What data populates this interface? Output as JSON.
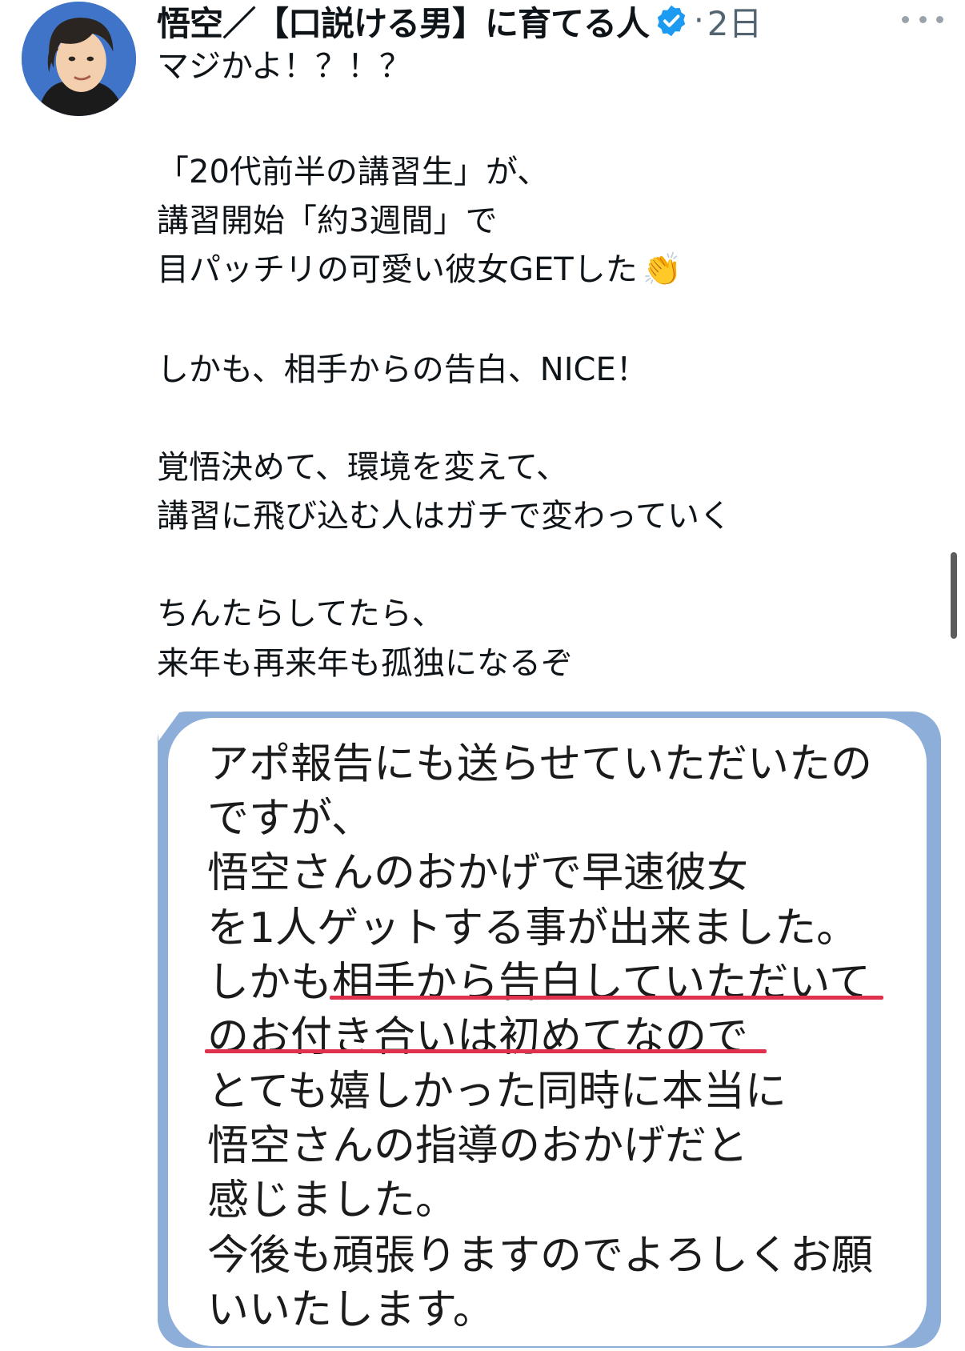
{
  "post": {
    "author_name": "悟空／【口説ける男】に育てる人",
    "separator": "·",
    "time": "2日",
    "lines": [
      "マジかよ！？！？",
      "「20代前半の講習生」が、",
      "講習開始「約3週間」で",
      "目パッチリの可愛い彼女GETした",
      "しかも、相手からの告白、NICE！",
      "覚悟決めて、環境を変えて、",
      "講習に飛び込む人はガチで変わっていく",
      "ちんたらしてたら、",
      "来年も再来年も孤独になるぞ"
    ],
    "emoji": "👏"
  },
  "screenshot_card": {
    "lines": [
      "アポ報告にも送らせていただいたの",
      "ですが、",
      "悟空さんのおかげで早速彼女",
      "を1人ゲットする事が出来ました。",
      "しかも相手から告白していただいて",
      "のお付き合いは初めてなので",
      "とても嬉しかった同時に本当に",
      "悟空さんの指導のおかげだと",
      "感じました。",
      "今後も頑張りますのでよろしくお願",
      "いいたします。"
    ]
  },
  "colors": {
    "verified": "#1d9bf0",
    "card_border": "#8eaeda",
    "underline": "#e0314e",
    "secondary_text": "#536471"
  },
  "icons": [
    "avatar",
    "verified-badge-icon",
    "more-options-icon",
    "clap-emoji"
  ]
}
